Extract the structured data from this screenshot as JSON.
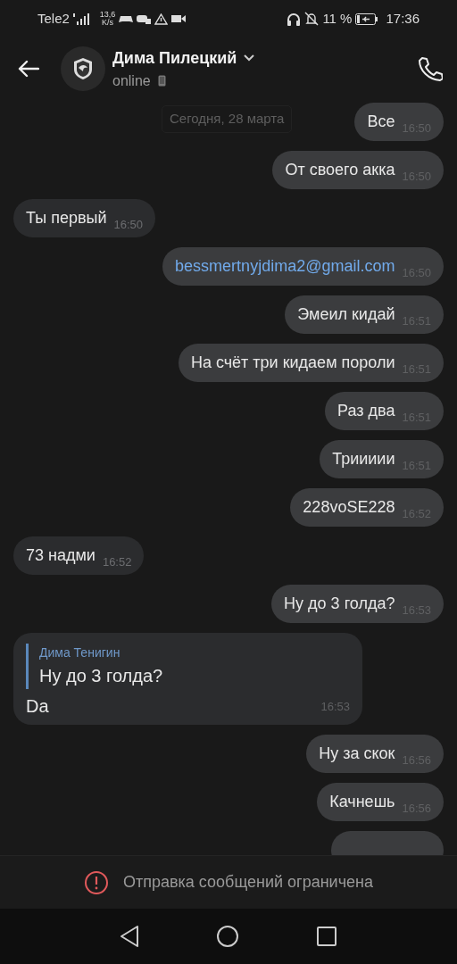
{
  "status_bar": {
    "carrier": "Tele2",
    "speed_value": "13,6",
    "speed_unit": "K/s",
    "battery_text": "11 %",
    "time": "17:36"
  },
  "header": {
    "name": "Дима Пилецкий",
    "presence": "online"
  },
  "date_chip": "Сегодня, 28 марта",
  "messages": [
    {
      "outgoing": true,
      "kind": "text",
      "text": "Все",
      "time": "16:50"
    },
    {
      "outgoing": true,
      "kind": "text",
      "text": "От своего акка",
      "time": "16:50"
    },
    {
      "outgoing": false,
      "kind": "text",
      "text": "Ты первый",
      "time": "16:50"
    },
    {
      "outgoing": true,
      "kind": "link",
      "text": "bessmertnyjdima2@gmail.com",
      "time": "16:50"
    },
    {
      "outgoing": true,
      "kind": "text",
      "text": "Эмеил кидай",
      "time": "16:51"
    },
    {
      "outgoing": true,
      "kind": "text",
      "text": "На счёт три кидаем пороли",
      "time": "16:51"
    },
    {
      "outgoing": true,
      "kind": "text",
      "text": "Раз два",
      "time": "16:51"
    },
    {
      "outgoing": true,
      "kind": "text",
      "text": "Триииии",
      "time": "16:51"
    },
    {
      "outgoing": true,
      "kind": "text",
      "text": "228voSE228",
      "time": "16:52"
    },
    {
      "outgoing": false,
      "kind": "text",
      "text": "73 надми",
      "time": "16:52"
    },
    {
      "outgoing": true,
      "kind": "text",
      "text": "Ну до 3 голда?",
      "time": "16:53"
    },
    {
      "outgoing": false,
      "kind": "reply",
      "reply_author": "Дима Тенигин",
      "reply_text": "Ну до 3 голда?",
      "text": "Da",
      "time": "16:53"
    },
    {
      "outgoing": true,
      "kind": "text",
      "text": "Ну за скок",
      "time": "16:56"
    },
    {
      "outgoing": true,
      "kind": "text",
      "text": "Качнешь",
      "time": "16:56"
    },
    {
      "outgoing": true,
      "kind": "clipped"
    }
  ],
  "restriction": "Отправка сообщений ограничена"
}
